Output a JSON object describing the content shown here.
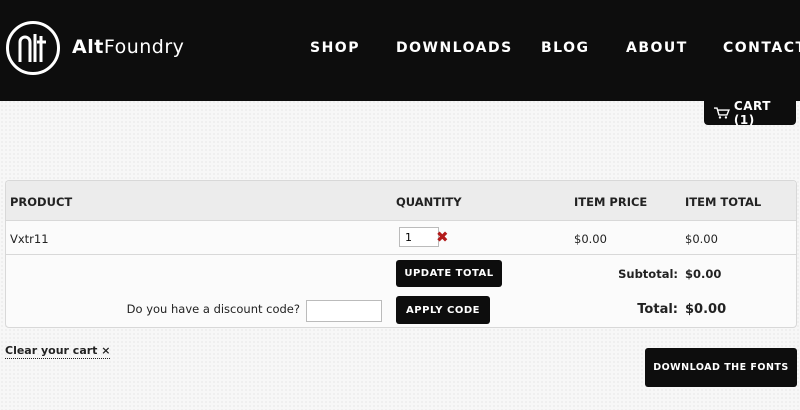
{
  "header": {
    "brand_bold": "Alt",
    "brand_regular": "Foundry",
    "nav": [
      "SHOP",
      "DOWNLOADS",
      "BLOG",
      "ABOUT",
      "CONTACT"
    ],
    "cart_label": "CART (1)"
  },
  "table": {
    "columns": [
      "PRODUCT",
      "QUANTITY",
      "ITEM PRICE",
      "ITEM TOTAL"
    ],
    "rows": [
      {
        "product": "Vxtr11",
        "quantity": "1",
        "item_price": "$0.00",
        "item_total": "$0.00"
      }
    ],
    "update_label": "UPDATE TOTAL",
    "subtotal_label": "Subtotal:",
    "subtotal_value": "$0.00",
    "discount_prompt": "Do you have a discount code?",
    "discount_value": "",
    "apply_label": "APPLY CODE",
    "total_label": "Total:",
    "total_value": "$0.00"
  },
  "footer": {
    "clear_cart": "Clear your cart ×",
    "download_label": "DOWNLOAD THE FONTS"
  },
  "colors": {
    "header_bg": "#0d0d0d",
    "remove": "#b31b1b"
  },
  "icons": {
    "logo": "altfoundry-logo-icon",
    "cart": "cart-icon",
    "remove": "remove-x-icon"
  }
}
